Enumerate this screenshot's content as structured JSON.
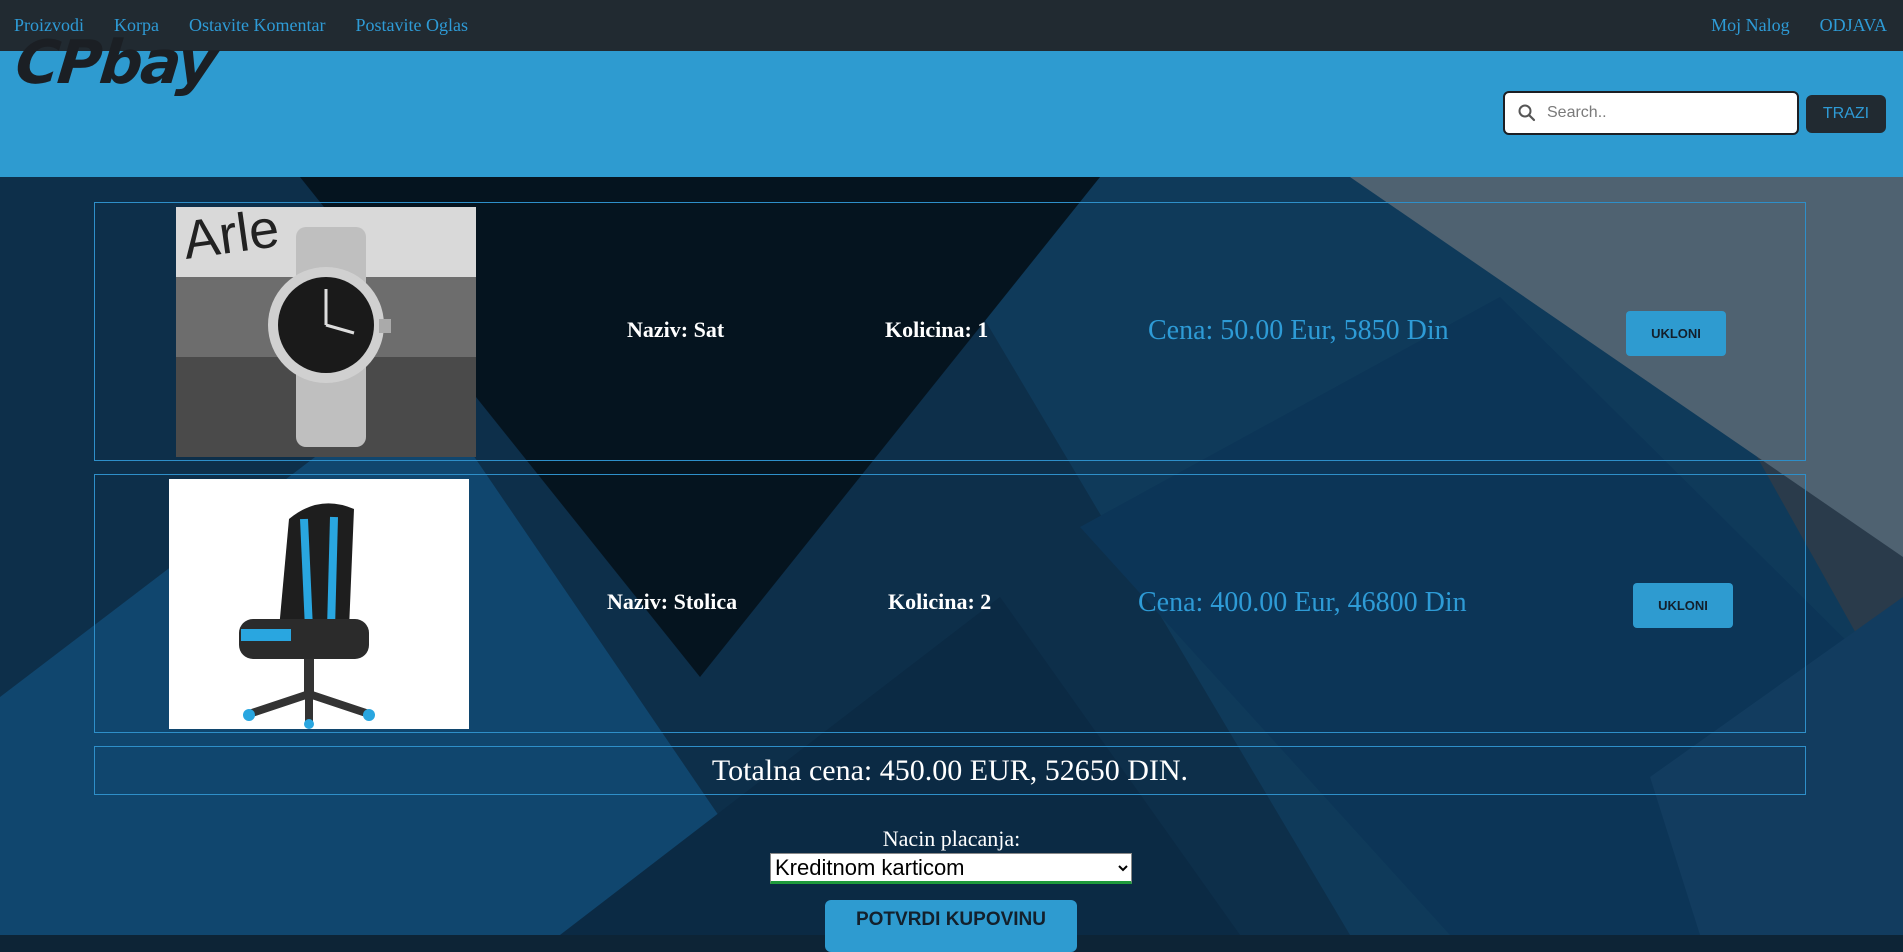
{
  "nav": {
    "left": [
      "Proizvodi",
      "Korpa",
      "Ostavite Komentar",
      "Postavite Oglas"
    ],
    "right": [
      "Moj Nalog",
      "ODJAVA"
    ]
  },
  "header": {
    "logo": "CPbay",
    "search_placeholder": "Search..",
    "search_button": "TRAZI"
  },
  "cart": {
    "items": [
      {
        "name": "Naziv: Sat",
        "quantity": "Kolicina: 1",
        "price": "Cena: 50.00 Eur, 5850 Din",
        "remove_label": "UKLONI",
        "image": "wristwatch"
      },
      {
        "name": "Naziv: Stolica",
        "quantity": "Kolicina: 2",
        "price": "Cena: 400.00 Eur, 46800 Din",
        "remove_label": "UKLONI",
        "image": "gaming-chair"
      }
    ],
    "total": "Totalna cena: 450.00 EUR, 52650 DIN."
  },
  "payment": {
    "label": "Nacin placanja:",
    "selected": "Kreditnom karticom",
    "confirm_label": "POTVRDI KUPOVINU"
  },
  "colors": {
    "accent": "#2e9bd0",
    "nav_bg": "#212a31",
    "link": "#2e9bd6"
  }
}
